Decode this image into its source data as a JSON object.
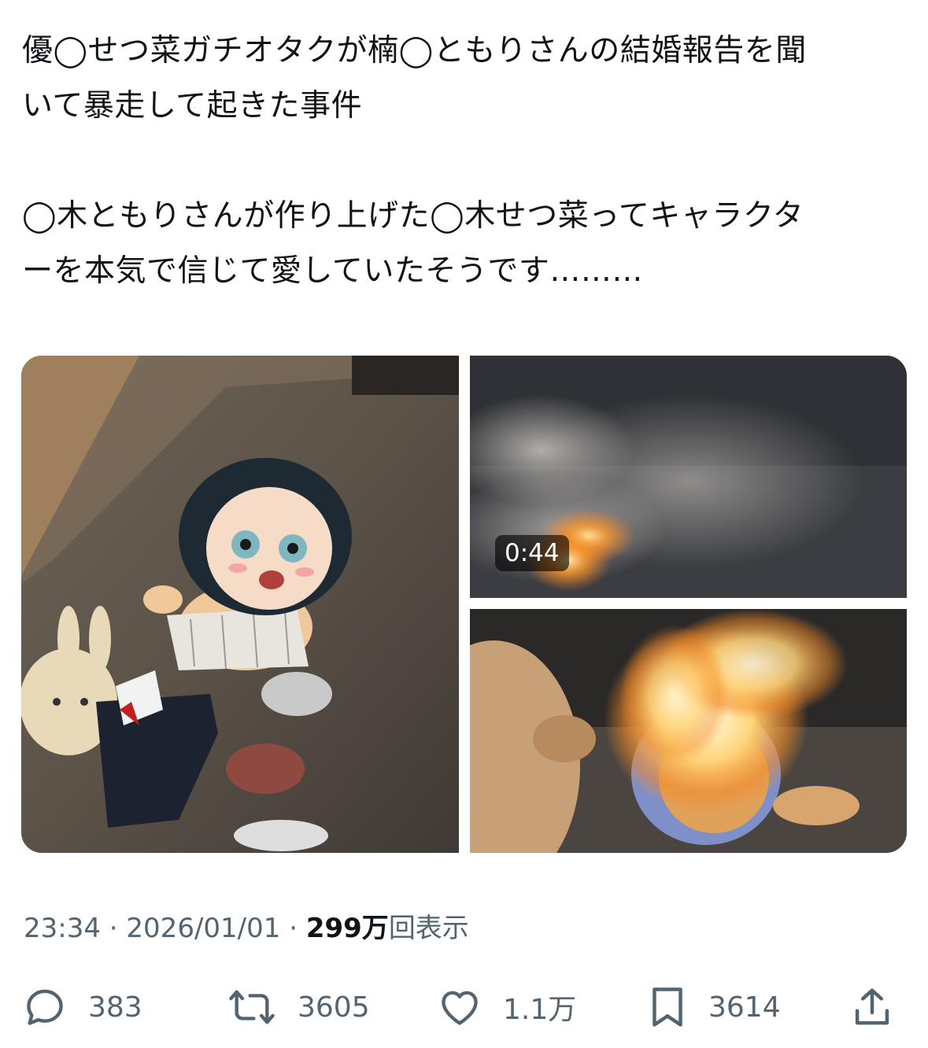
{
  "tweet": {
    "lines": [
      "優◯せつ菜ガチオタクが楠◯ともりさんの結婚報告を聞",
      "いて暴走して起きた事件",
      "",
      "◯木ともりさんが作り上げた◯木せつ菜ってキャラクタ",
      "ーを本気で信じて愛していたそうです………"
    ]
  },
  "media": {
    "video_duration": "0:44"
  },
  "meta": {
    "time": "23:34",
    "separator": "·",
    "date": "2026/01/01",
    "views_count": "299万",
    "views_label": "回表示"
  },
  "actions": {
    "replies": "383",
    "retweets": "3605",
    "likes": "1.1万",
    "bookmarks": "3614"
  },
  "colors": {
    "text": "#0f1419",
    "secondary": "#536471"
  },
  "icons": [
    "reply-icon",
    "retweet-icon",
    "like-icon",
    "bookmark-icon",
    "share-icon"
  ]
}
